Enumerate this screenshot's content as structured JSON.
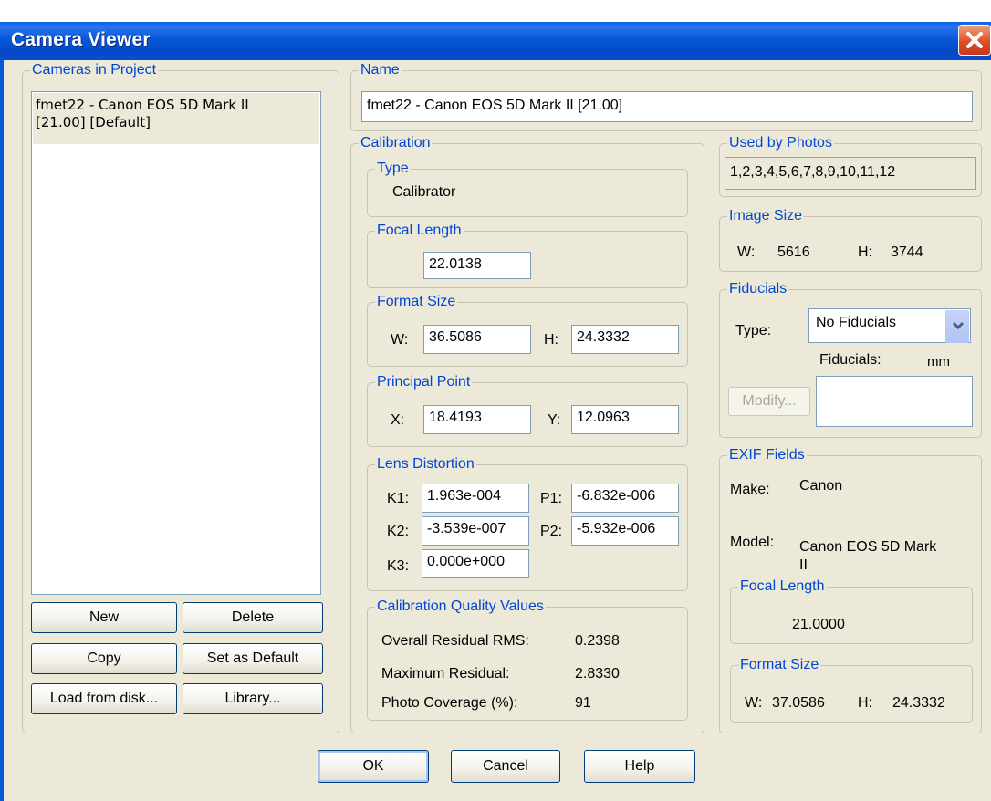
{
  "window": {
    "title": "Camera Viewer"
  },
  "cameras_panel": {
    "legend": "Cameras in Project",
    "items": [
      {
        "line1": "fmet22 - Canon EOS 5D Mark II",
        "line2": "[21.00] [Default]"
      }
    ],
    "buttons": {
      "new": "New",
      "delete": "Delete",
      "copy": "Copy",
      "set_default": "Set as Default",
      "load": "Load from disk...",
      "library": "Library..."
    }
  },
  "name_group": {
    "legend": "Name",
    "value": "fmet22 - Canon EOS 5D Mark II [21.00]"
  },
  "calibration": {
    "legend": "Calibration",
    "type": {
      "legend": "Type",
      "value": "Calibrator"
    },
    "focal_length": {
      "legend": "Focal Length",
      "value": "22.0138"
    },
    "format_size": {
      "legend": "Format Size",
      "w_label": "W:",
      "w": "36.5086",
      "h_label": "H:",
      "h": "24.3332"
    },
    "principal_point": {
      "legend": "Principal Point",
      "x_label": "X:",
      "x": "18.4193",
      "y_label": "Y:",
      "y": "12.0963"
    },
    "lens_distortion": {
      "legend": "Lens Distortion",
      "k1_label": "K1:",
      "k1": "1.963e-004",
      "p1_label": "P1:",
      "p1": "-6.832e-006",
      "k2_label": "K2:",
      "k2": "-3.539e-007",
      "p2_label": "P2:",
      "p2": "-5.932e-006",
      "k3_label": "K3:",
      "k3": "0.000e+000"
    },
    "quality": {
      "legend": "Calibration Quality Values",
      "rms_label": "Overall Residual RMS:",
      "rms": "0.2398",
      "max_label": "Maximum Residual:",
      "max": "2.8330",
      "coverage_label": "Photo Coverage (%):",
      "coverage": "91"
    }
  },
  "used_by": {
    "legend": "Used by Photos",
    "value": "1,2,3,4,5,6,7,8,9,10,11,12"
  },
  "image_size": {
    "legend": "Image Size",
    "w_label": "W:",
    "w": "5616",
    "h_label": "H:",
    "h": "3744"
  },
  "fiducials": {
    "legend": "Fiducials",
    "type_label": "Type:",
    "type_value": "No Fiducials",
    "fid_label": "Fiducials:",
    "unit": "mm",
    "modify": "Modify..."
  },
  "exif": {
    "legend": "EXIF Fields",
    "make_label": "Make:",
    "make": "Canon",
    "model_label": "Model:",
    "model_line1": "Canon EOS 5D Mark",
    "model_line2": "II",
    "focal_legend": "Focal Length",
    "focal": "21.0000",
    "format_legend": "Format Size",
    "w_label": "W:",
    "w": "37.0586",
    "h_label": "H:",
    "h": "24.3332"
  },
  "footer": {
    "ok": "OK",
    "cancel": "Cancel",
    "help": "Help"
  },
  "colors": {
    "titlebar": "#0757d6",
    "legend_text": "#0046d5",
    "dialog_bg": "#ece9d8",
    "close_button": "#e04e24"
  }
}
